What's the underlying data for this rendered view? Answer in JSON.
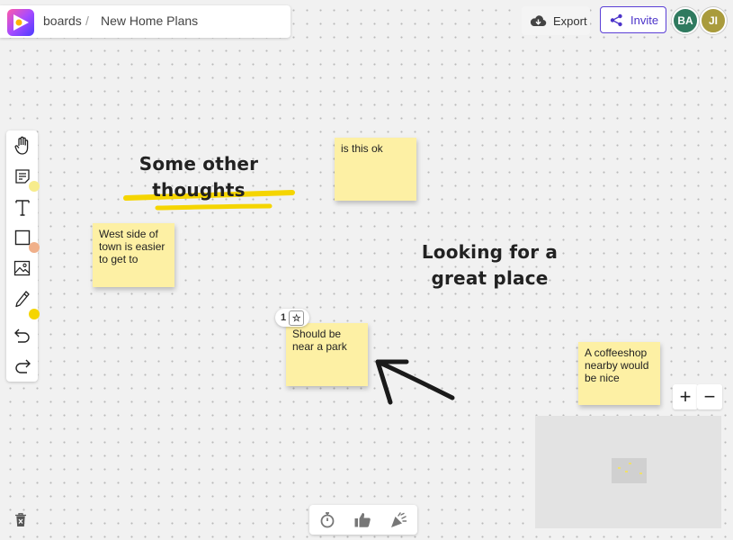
{
  "header": {
    "app_name": "boards",
    "separator": "/",
    "board_title": "New Home Plans",
    "export_label": "Export",
    "invite_label": "Invite"
  },
  "collaborators": [
    {
      "initials": "BA",
      "color": "#2f7a5f"
    },
    {
      "initials": "JI",
      "color": "#a99b3c"
    }
  ],
  "toolbar": {
    "tools": [
      "hand-icon",
      "sticky-note-icon",
      "text-icon",
      "rectangle-icon",
      "image-icon",
      "pen-icon",
      "undo-icon",
      "redo-icon"
    ],
    "note_color": "#f7ec8c",
    "shape_color": "#f0b08a",
    "pen_color": "#f5d500"
  },
  "canvas": {
    "headings": [
      {
        "text_line1": "Some other",
        "text_line2": "thoughts"
      },
      {
        "text_line1": "Looking for a",
        "text_line2": "great place"
      }
    ],
    "notes": [
      {
        "text": "is this ok"
      },
      {
        "text": "West side of town is easier to get to"
      },
      {
        "text": "Should be near a park"
      },
      {
        "text": "A coffeeshop nearby would be nice"
      }
    ],
    "vote_count": "1",
    "note_color": "#fdf0a4"
  },
  "zoom": {
    "in": "+",
    "out": "−"
  }
}
